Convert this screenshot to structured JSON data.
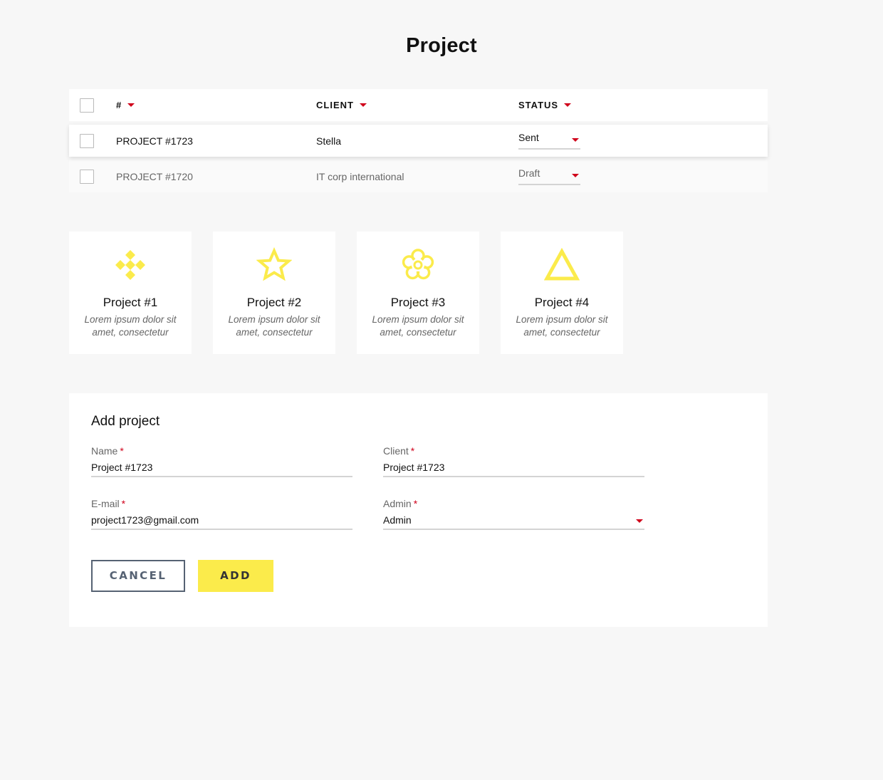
{
  "page": {
    "title": "Project"
  },
  "table": {
    "headers": {
      "number": "#",
      "client": "CLIENT",
      "status": "STATUS"
    },
    "rows": [
      {
        "project": "PROJECT #1723",
        "client": "Stella",
        "status": "Sent"
      },
      {
        "project": "PROJECT #1720",
        "client": "IT corp international",
        "status": "Draft"
      }
    ]
  },
  "cards": [
    {
      "title": "Project #1",
      "desc": "Lorem ipsum dolor sit amet,  consectetur",
      "icon": "diamonds-icon"
    },
    {
      "title": "Project #2",
      "desc": "Lorem ipsum dolor sit amet,  consectetur",
      "icon": "star-icon"
    },
    {
      "title": "Project #3",
      "desc": "Lorem ipsum dolor sit amet,  consectetur",
      "icon": "flower-icon"
    },
    {
      "title": "Project #4",
      "desc": "Lorem ipsum dolor sit amet,  consectetur",
      "icon": "triangle-icon"
    }
  ],
  "form": {
    "title": "Add project",
    "name": {
      "label": "Name",
      "value": "Project #1723"
    },
    "client": {
      "label": "Client",
      "value": "Project #1723"
    },
    "email": {
      "label": "E-mail",
      "value": "project1723@gmail.com"
    },
    "admin": {
      "label": "Admin",
      "value": "Admin"
    },
    "required_mark": "*",
    "cancel_label": "CANCEL",
    "add_label": "ADD"
  },
  "colors": {
    "accent": "#fbeb4b",
    "caret": "#d0021b",
    "button_outline": "#566273",
    "background": "#f7f7f7"
  }
}
